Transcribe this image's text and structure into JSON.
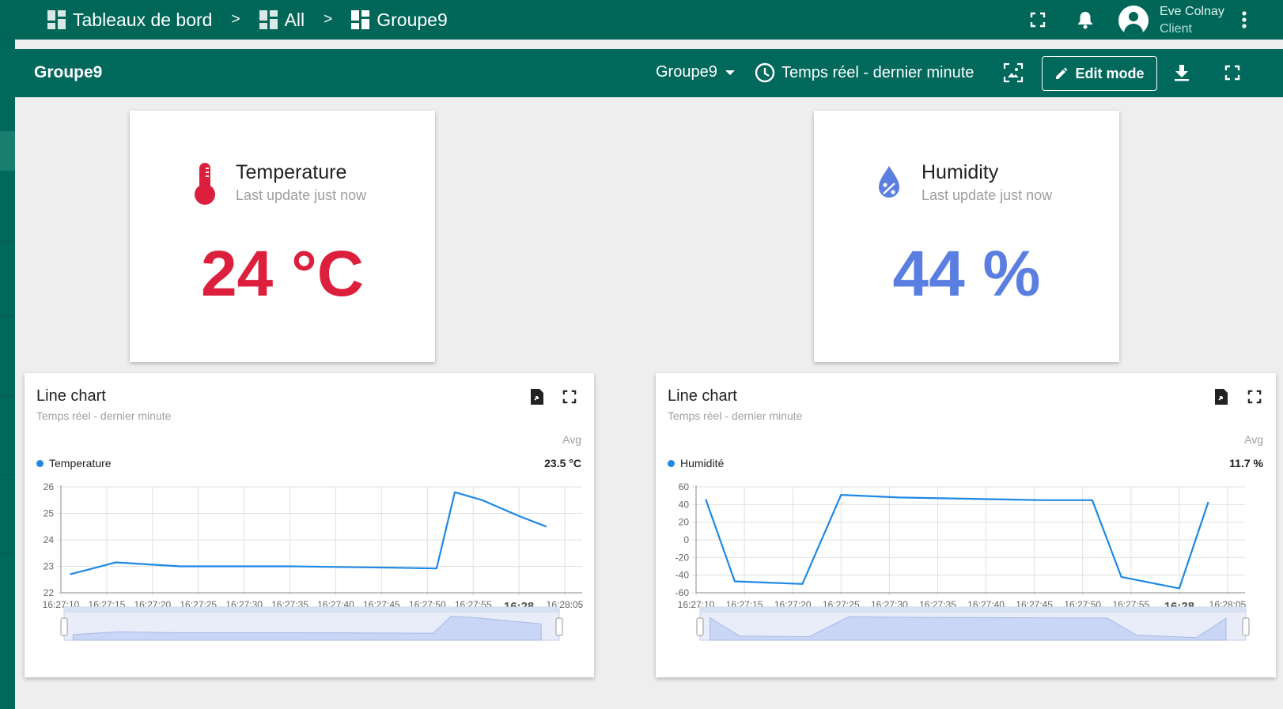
{
  "topbar": {
    "breadcrumbs": [
      {
        "label": "Tableaux de bord",
        "icon": "dashboards-icon"
      },
      {
        "label": "All",
        "icon": "dashboards-icon"
      },
      {
        "label": "Groupe9",
        "icon": "dashboard-icon"
      }
    ],
    "separator": ">",
    "user": {
      "name": "Eve Colnay",
      "role": "Client"
    },
    "accent": "#006758"
  },
  "dashbar": {
    "title": "Groupe9",
    "state": "Groupe9",
    "timewindow": "Temps réel - dernier minute",
    "edit_label": "Edit mode"
  },
  "cards": {
    "temperature": {
      "title": "Temperature",
      "subtitle": "Last update just now",
      "value": "24 °C",
      "color": "#dc1f3c",
      "icon": "thermometer-icon"
    },
    "humidity": {
      "title": "Humidity",
      "subtitle": "Last update just now",
      "value": "44 %",
      "color": "#5a7fe0",
      "icon": "water-percent-icon"
    }
  },
  "charts": {
    "temp": {
      "title": "Line chart",
      "subtitle": "Temps réel - dernier minute",
      "avg_label": "Avg",
      "legend": "Temperature",
      "avg_value": "23.5 °C"
    },
    "hum": {
      "title": "Line chart",
      "subtitle": "Temps réel - dernier minute",
      "avg_label": "Avg",
      "legend": "Humidité",
      "avg_value": "11.7 %"
    }
  },
  "chart_data": [
    {
      "type": "line",
      "title": "Line chart",
      "series": [
        {
          "name": "Temperature",
          "color": "#1e88e5",
          "x": [
            "16:27:11",
            "16:27:16",
            "16:27:23",
            "16:27:30",
            "16:27:35",
            "16:27:46",
            "16:27:51",
            "16:27:53",
            "16:27:56",
            "16:28:00",
            "16:28:03"
          ],
          "values": [
            22.7,
            23.15,
            23.0,
            23.0,
            23.0,
            22.95,
            22.92,
            25.8,
            25.5,
            24.9,
            24.5
          ]
        }
      ],
      "x_ticks": [
        "16:27:10",
        "16:27:15",
        "16:27:20",
        "16:27:25",
        "16:27:30",
        "16:27:35",
        "16:27:40",
        "16:27:45",
        "16:27:50",
        "16:27:55",
        "16:28",
        "16:28:05"
      ],
      "y_ticks": [
        "26",
        "25",
        "24",
        "23",
        "22"
      ],
      "ylim": [
        22,
        26
      ],
      "grid": true,
      "legend": "top-left"
    },
    {
      "type": "line",
      "title": "Line chart",
      "series": [
        {
          "name": "Humidité",
          "color": "#1e88e5",
          "x": [
            "16:27:11",
            "16:27:14",
            "16:27:21",
            "16:27:25",
            "16:27:31",
            "16:27:46",
            "16:27:51",
            "16:27:54",
            "16:28:00",
            "16:28:03"
          ],
          "values": [
            46,
            -47,
            -50,
            51,
            48,
            45,
            45,
            -42,
            -55,
            43
          ]
        }
      ],
      "x_ticks": [
        "16:27:10",
        "16:27:15",
        "16:27:20",
        "16:27:25",
        "16:27:30",
        "16:27:35",
        "16:27:40",
        "16:27:45",
        "16:27:50",
        "16:27:55",
        "16:28",
        "16:28:05"
      ],
      "y_ticks": [
        "60",
        "40",
        "20",
        "0",
        "-20",
        "-40",
        "-60"
      ],
      "ylim": [
        -60,
        60
      ],
      "grid": true,
      "legend": "top-left"
    }
  ]
}
